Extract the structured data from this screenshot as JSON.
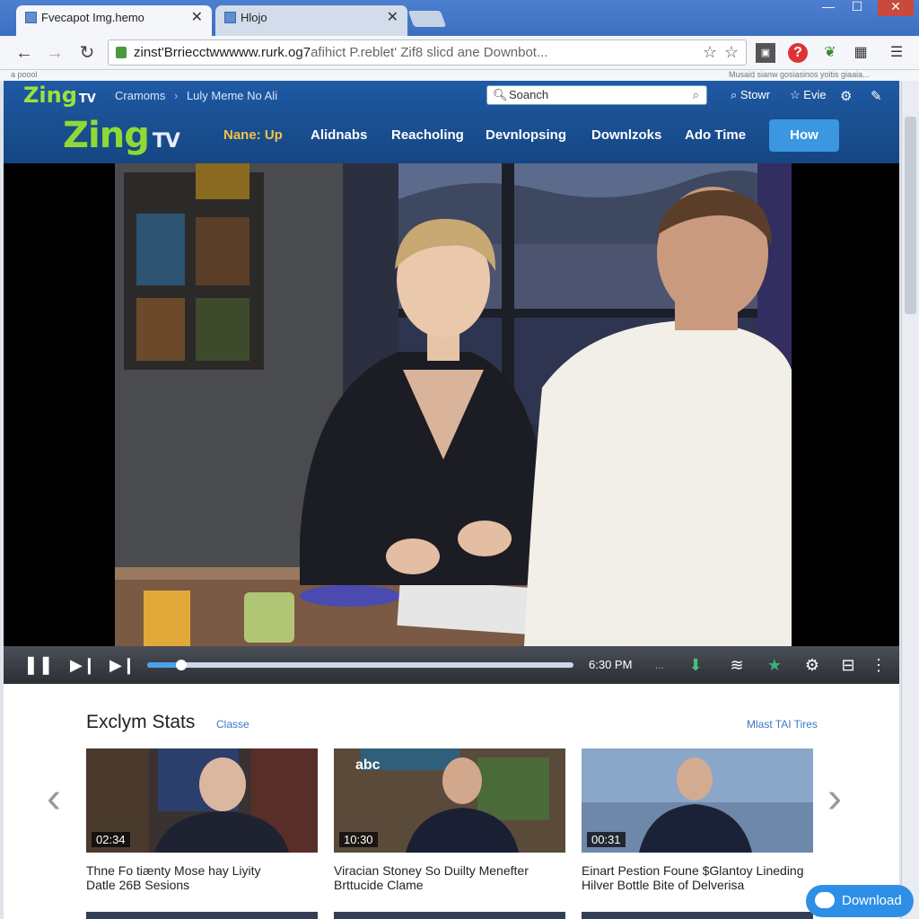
{
  "browser": {
    "tabs": [
      {
        "title": "Fvecapot Img.hemo",
        "active": true
      },
      {
        "title": "Hlojo",
        "active": false
      }
    ],
    "url_host": "zinst'Brriecctwwwww.rurk.og7",
    "url_rest": "afihict P.reblet' Zif8 slicd ane Downbot...",
    "subbar_left": "a poool",
    "subbar_right": "Musaid sianw gosiasinos yoitis giaaia..."
  },
  "site": {
    "logo_word": "Zing",
    "logo_suffix": "TV",
    "breadcrumb": [
      "Cramoms",
      "Luly Meme No Ali"
    ],
    "search_placeholder": "Soanch",
    "header_tools": [
      {
        "icon": "search-icon",
        "label": "Stowr"
      },
      {
        "icon": "star-icon",
        "label": "Evie"
      }
    ],
    "nav": [
      {
        "label": "Nane: Up",
        "active": true
      },
      {
        "label": "Alidnabs",
        "active": false
      },
      {
        "label": "Reacholing",
        "active": false
      },
      {
        "label": "Devnlopsing",
        "active": false
      },
      {
        "label": "Downlzoks",
        "active": false
      },
      {
        "label": "Ado Time",
        "active": false
      }
    ],
    "cta_label": "How"
  },
  "player": {
    "time": "6:30 PM",
    "progress": 0.08,
    "extra": "..."
  },
  "section": {
    "title": "Exclym Stats",
    "link": "Classe",
    "right_link": "Mlast TAI Tires",
    "cards": [
      {
        "duration": "02:34",
        "title_line1": "Thne Fo tiænty Mose hay Liyity",
        "title_line2": "Datle 26B Sesions"
      },
      {
        "duration": "10:30",
        "title_line1": "Viracian Stoney So Duilty Menefter",
        "title_line2": "Brttucide Clame",
        "channel_mark": "abc"
      },
      {
        "duration": "00:31",
        "title_line1": "Einart Pestion Foune $Glantoy Lineding",
        "title_line2": "Hilver Bottle Bite of Delverisa"
      }
    ]
  },
  "download_label": "Download"
}
